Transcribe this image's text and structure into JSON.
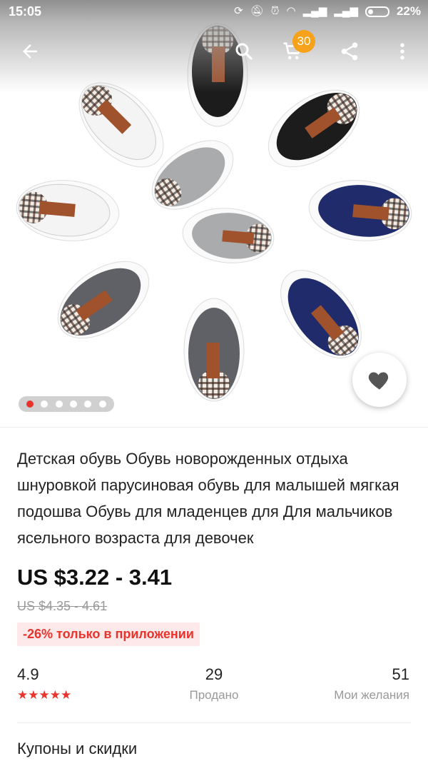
{
  "status_bar": {
    "time": "15:05",
    "battery": "22%"
  },
  "toolbar": {
    "cart_count": "30"
  },
  "carousel": {
    "slide_count": 6,
    "active_index": 0
  },
  "product": {
    "title": "Детская обувь Обувь новорожденных отдыха шнуровкой парусиновая обувь для малышей мягкая подошва Обувь для младенцев для Для мальчиков ясельного возраста для девочек",
    "price": "US $3.22 - 3.41",
    "old_price": "US $4.35 - 4.61",
    "discount_badge": "-26% только в приложении"
  },
  "stats": {
    "rating": "4.9",
    "rating_stars": "★★★★★",
    "sold_count": "29",
    "sold_label": "Продано",
    "wishlist_count": "51",
    "wishlist_label": "Мои желания"
  },
  "sections": {
    "coupons_title": "Купоны и скидки"
  },
  "colors": {
    "accent_red": "#e8342c",
    "badge_orange": "#f6a21b"
  },
  "icons": [
    "back-arrow-icon",
    "search-icon",
    "cart-icon",
    "share-icon",
    "more-vert-icon",
    "heart-icon"
  ]
}
